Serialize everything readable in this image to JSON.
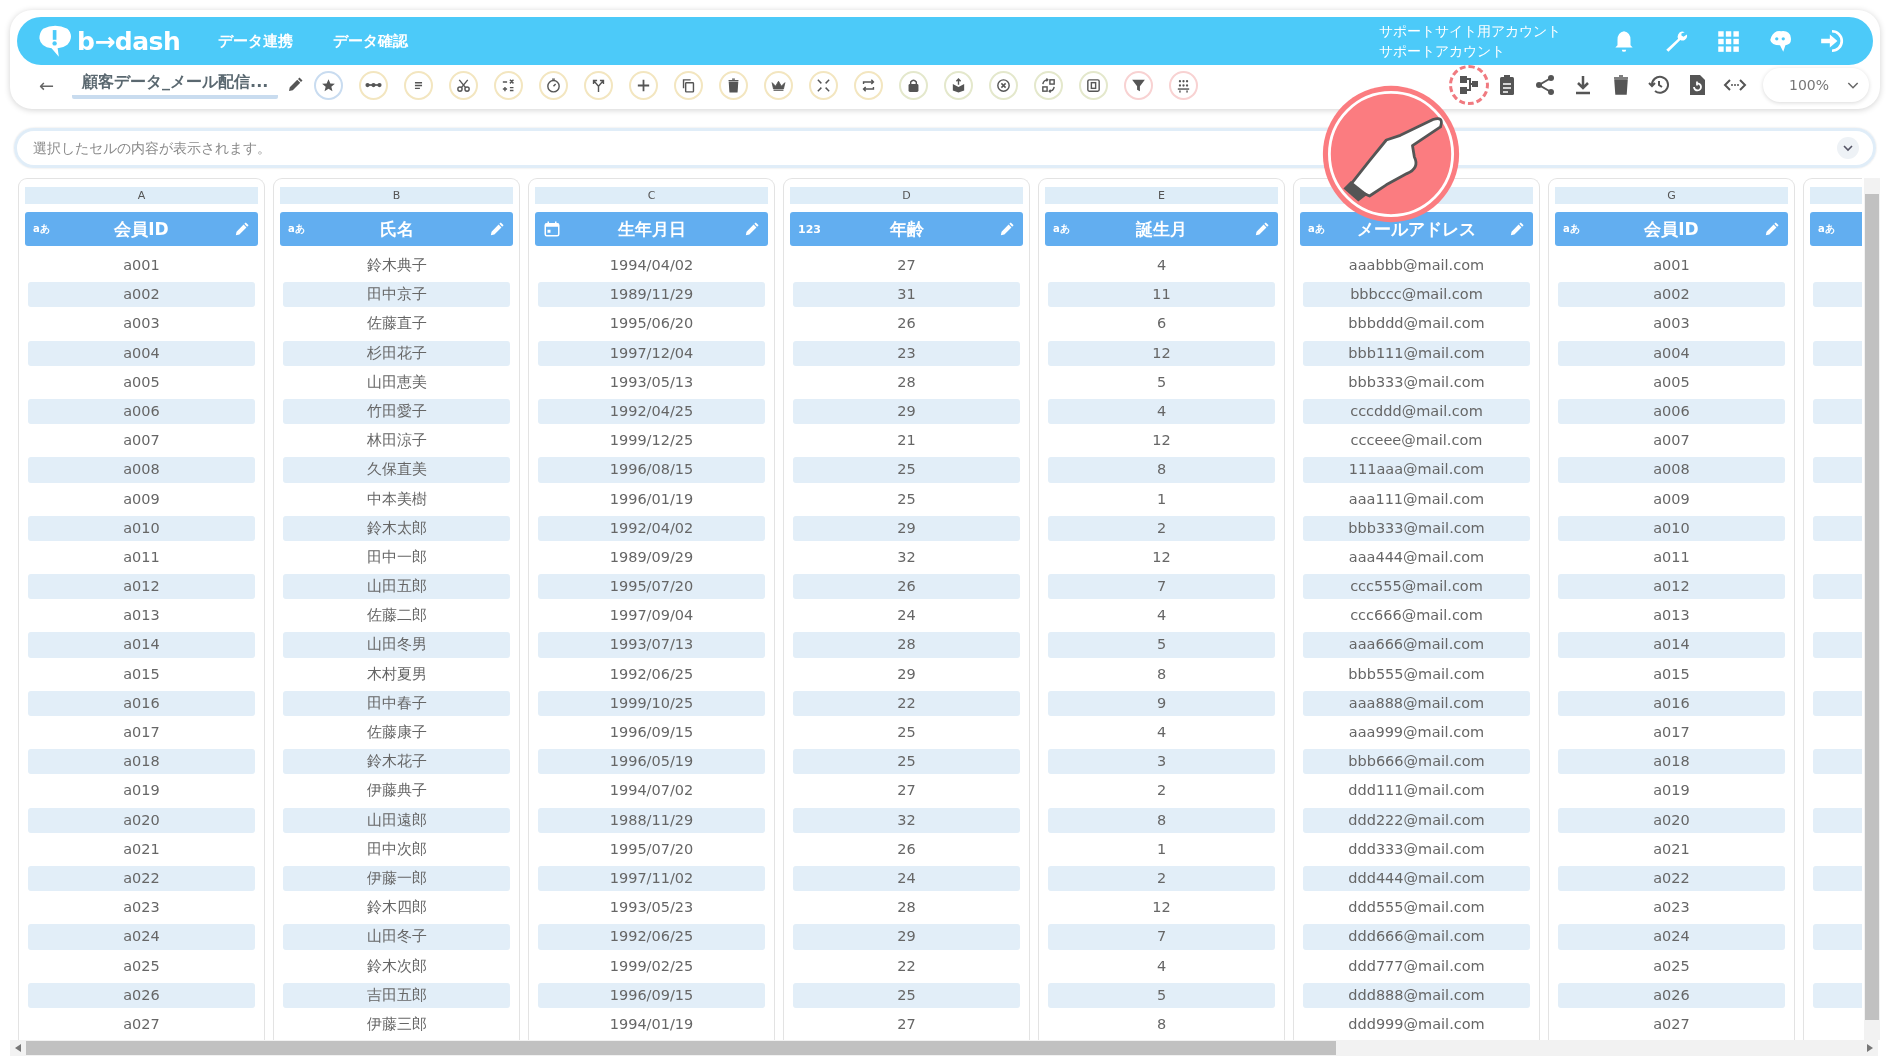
{
  "app_bar": {
    "logo": "b→dash",
    "nav": [
      {
        "label": "データ連携"
      },
      {
        "label": "データ確認"
      }
    ],
    "account": {
      "site": "サポートサイト用アカウント",
      "name": "サポートアカウント"
    }
  },
  "toolbar": {
    "back": "←",
    "title": "顧客データ_メール配信...",
    "tools": [
      {
        "color": "#c9dcf0"
      },
      {
        "color": "#f3e6c0"
      },
      {
        "color": "#f3e6c0"
      },
      {
        "color": "#f3e6c0"
      },
      {
        "color": "#f3e6c0"
      },
      {
        "color": "#f3e6c0"
      },
      {
        "color": "#f3e6c0"
      },
      {
        "color": "#f3e6c0"
      },
      {
        "color": "#f3e6c0"
      },
      {
        "color": "#f3e6c0"
      },
      {
        "color": "#f3e6c0"
      },
      {
        "color": "#f3e6c0"
      },
      {
        "color": "#f3e6c0"
      },
      {
        "color": "#e4e8cc"
      },
      {
        "color": "#e4e8cc"
      },
      {
        "color": "#e4e8cc"
      },
      {
        "color": "#e4e8cc"
      },
      {
        "color": "#e4e8cc"
      },
      {
        "color": "#f8d2d2"
      },
      {
        "color": "#f8d2d2"
      }
    ],
    "actions": [
      {
        "highlighted": true
      },
      {
        "highlighted": false
      },
      {
        "highlighted": false
      },
      {
        "highlighted": false
      },
      {
        "highlighted": false
      },
      {
        "highlighted": false
      },
      {
        "highlighted": false
      },
      {
        "highlighted": false
      }
    ],
    "zoom": "100%"
  },
  "cell_bar": {
    "placeholder": "選択したセルの内容が表示されます。"
  },
  "table": {
    "columns": [
      {
        "letter": "A",
        "name": "会員ID",
        "kind": "text",
        "type_icon": "aあ"
      },
      {
        "letter": "B",
        "name": "氏名",
        "kind": "text",
        "type_icon": "aあ"
      },
      {
        "letter": "C",
        "name": "生年月日",
        "kind": "date"
      },
      {
        "letter": "D",
        "name": "年齢",
        "kind": "number",
        "type_icon": "123"
      },
      {
        "letter": "E",
        "name": "誕生月",
        "kind": "text",
        "type_icon": "aあ"
      },
      {
        "name": "メールアドレス",
        "kind": "text",
        "type_icon": "aあ"
      },
      {
        "letter": "G",
        "name": "会員ID",
        "kind": "text",
        "type_icon": "aあ"
      },
      {
        "kind": "text",
        "type_icon": "aあ"
      }
    ],
    "rows": [
      [
        "a001",
        "鈴木典子",
        "1994/04/02",
        "27",
        "4",
        "aaabbb@mail.com",
        "a001"
      ],
      [
        "a002",
        "田中京子",
        "1989/11/29",
        "31",
        "11",
        "bbbccc@mail.com",
        "a002"
      ],
      [
        "a003",
        "佐藤直子",
        "1995/06/20",
        "26",
        "6",
        "bbbddd@mail.com",
        "a003"
      ],
      [
        "a004",
        "杉田花子",
        "1997/12/04",
        "23",
        "12",
        "bbb111@mail.com",
        "a004"
      ],
      [
        "a005",
        "山田恵美",
        "1993/05/13",
        "28",
        "5",
        "bbb333@mail.com",
        "a005"
      ],
      [
        "a006",
        "竹田愛子",
        "1992/04/25",
        "29",
        "4",
        "cccddd@mail.com",
        "a006"
      ],
      [
        "a007",
        "林田涼子",
        "1999/12/25",
        "21",
        "12",
        "ccceee@mail.com",
        "a007"
      ],
      [
        "a008",
        "久保直美",
        "1996/08/15",
        "25",
        "8",
        "111aaa@mail.com",
        "a008"
      ],
      [
        "a009",
        "中本美樹",
        "1996/01/19",
        "25",
        "1",
        "aaa111@mail.com",
        "a009"
      ],
      [
        "a010",
        "鈴木太郎",
        "1992/04/02",
        "29",
        "2",
        "bbb333@mail.com",
        "a010"
      ],
      [
        "a011",
        "田中一郎",
        "1989/09/29",
        "32",
        "12",
        "aaa444@mail.com",
        "a011"
      ],
      [
        "a012",
        "山田五郎",
        "1995/07/20",
        "26",
        "7",
        "ccc555@mail.com",
        "a012"
      ],
      [
        "a013",
        "佐藤二郎",
        "1997/09/04",
        "24",
        "4",
        "ccc666@mail.com",
        "a013"
      ],
      [
        "a014",
        "山田冬男",
        "1993/07/13",
        "28",
        "5",
        "aaa666@mail.com",
        "a014"
      ],
      [
        "a015",
        "木村夏男",
        "1992/06/25",
        "29",
        "8",
        "bbb555@mail.com",
        "a015"
      ],
      [
        "a016",
        "田中春子",
        "1999/10/25",
        "22",
        "9",
        "aaa888@mail.com",
        "a016"
      ],
      [
        "a017",
        "佐藤康子",
        "1996/09/15",
        "25",
        "4",
        "aaa999@mail.com",
        "a017"
      ],
      [
        "a018",
        "鈴木花子",
        "1996/05/19",
        "25",
        "3",
        "bbb666@mail.com",
        "a018"
      ],
      [
        "a019",
        "伊藤典子",
        "1994/07/02",
        "27",
        "2",
        "ddd111@mail.com",
        "a019"
      ],
      [
        "a020",
        "山田遠郎",
        "1988/11/29",
        "32",
        "8",
        "ddd222@mail.com",
        "a020"
      ],
      [
        "a021",
        "田中次郎",
        "1995/07/20",
        "26",
        "1",
        "ddd333@mail.com",
        "a021"
      ],
      [
        "a022",
        "伊藤一郎",
        "1997/11/02",
        "24",
        "2",
        "ddd444@mail.com",
        "a022"
      ],
      [
        "a023",
        "鈴木四郎",
        "1993/05/23",
        "28",
        "12",
        "ddd555@mail.com",
        "a023"
      ],
      [
        "a024",
        "山田冬子",
        "1992/06/25",
        "29",
        "7",
        "ddd666@mail.com",
        "a024"
      ],
      [
        "a025",
        "鈴木次郎",
        "1999/02/25",
        "22",
        "4",
        "ddd777@mail.com",
        "a025"
      ],
      [
        "a026",
        "吉田五郎",
        "1996/09/15",
        "25",
        "5",
        "ddd888@mail.com",
        "a026"
      ],
      [
        "a027",
        "伊藤三郎",
        "1994/01/19",
        "27",
        "8",
        "ddd999@mail.com",
        "a027"
      ]
    ]
  }
}
